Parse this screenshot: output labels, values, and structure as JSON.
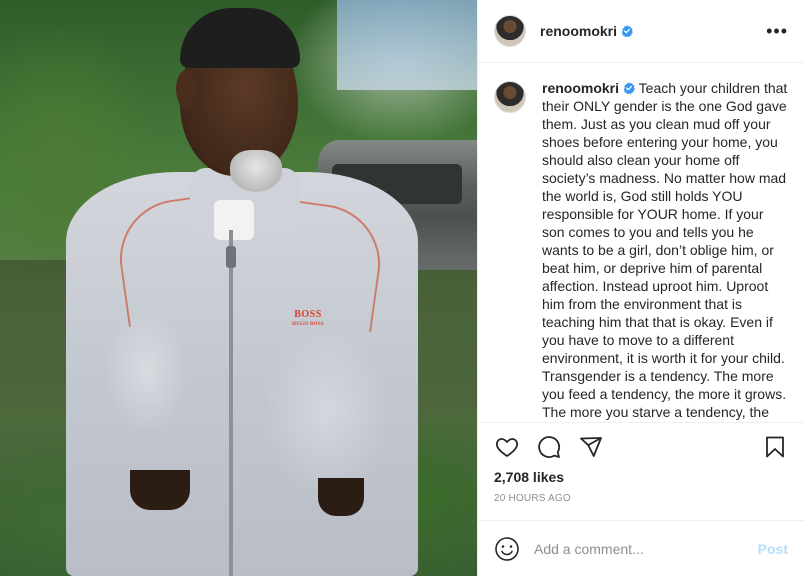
{
  "post": {
    "header": {
      "username": "renoomokri",
      "verified": true
    },
    "caption": {
      "username": "renoomokri",
      "text": "Teach your children that their ONLY gender is the one God gave them. Just as you clean mud off your shoes before entering your home, you should also clean your home off society’s madness. No matter how mad the world is, God still holds YOU responsible for YOUR home. If your son comes to you and tells you he wants to be a girl, don’t oblige him, or beat him, or deprive him of parental affection. Instead uproot him. Uproot him from the environment that is teaching him that that is okay. Even if you have to move to a different environment, it is worth it for your child. Transgender is a tendency. The more you feed a tendency, the more it grows. The more you starve a tendency, the more it"
    },
    "photo": {
      "brand_text": "BOSS",
      "brand_subtext": "HUGO BOSS"
    },
    "actions": {
      "like_icon": "heart-icon",
      "comment_icon": "comment-icon",
      "share_icon": "paper-plane-icon",
      "save_icon": "bookmark-icon"
    },
    "likes": "2,708 likes",
    "time_ago": "20 HOURS AGO",
    "comment_box": {
      "placeholder": "Add a comment...",
      "post_label": "Post"
    },
    "colors": {
      "verified_blue": "#3897f0",
      "post_button_disabled": "#b2dffc",
      "text_primary": "#262626",
      "text_secondary": "#8e8e8e",
      "divider": "#efefef"
    }
  }
}
